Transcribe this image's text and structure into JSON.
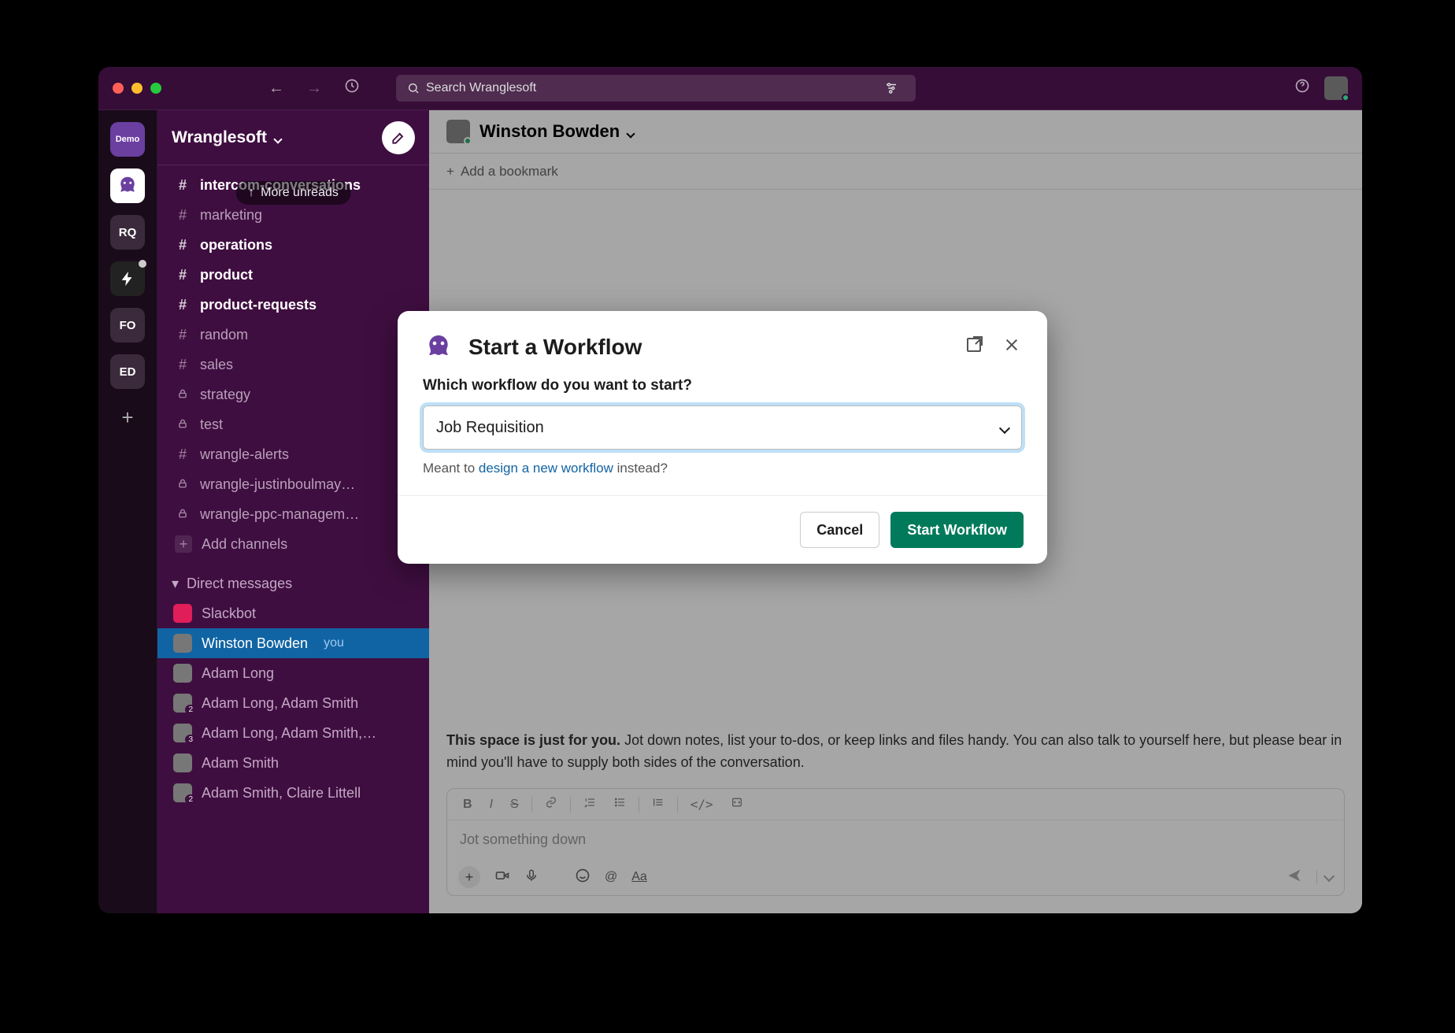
{
  "workspace": {
    "name": "Wranglesoft"
  },
  "search": {
    "placeholder": "Search Wranglesoft"
  },
  "rail": [
    {
      "label": "Demo",
      "kind": "demo"
    },
    {
      "label": "",
      "kind": "octo"
    },
    {
      "label": "RQ",
      "kind": "text"
    },
    {
      "label": "",
      "kind": "flash",
      "badge": true
    },
    {
      "label": "FO",
      "kind": "text",
      "badge": true
    },
    {
      "label": "ED",
      "kind": "text"
    }
  ],
  "unreads_pill": "More unreads",
  "channels": [
    {
      "name": "intercom-conversations",
      "icon": "#",
      "bold": true
    },
    {
      "name": "marketing",
      "icon": "#",
      "bold": false
    },
    {
      "name": "operations",
      "icon": "#",
      "bold": true
    },
    {
      "name": "product",
      "icon": "#",
      "bold": true
    },
    {
      "name": "product-requests",
      "icon": "#",
      "bold": true
    },
    {
      "name": "random",
      "icon": "#",
      "bold": false
    },
    {
      "name": "sales",
      "icon": "#",
      "bold": false
    },
    {
      "name": "strategy",
      "icon": "lock",
      "bold": false
    },
    {
      "name": "test",
      "icon": "lock",
      "bold": false
    },
    {
      "name": "wrangle-alerts",
      "icon": "#",
      "bold": false
    },
    {
      "name": "wrangle-justinboulmay…",
      "icon": "lock",
      "bold": false
    },
    {
      "name": "wrangle-ppc-managem…",
      "icon": "lock",
      "bold": false
    }
  ],
  "add_channels_label": "Add channels",
  "dm_section": "Direct messages",
  "dms": [
    {
      "name": "Slackbot"
    },
    {
      "name": "Winston Bowden",
      "you": "you",
      "active": true
    },
    {
      "name": "Adam Long"
    },
    {
      "name": "Adam Long, Adam Smith",
      "count": "2"
    },
    {
      "name": "Adam Long, Adam Smith,…",
      "count": "3"
    },
    {
      "name": "Adam Smith"
    },
    {
      "name": "Adam Smith, Claire Littell",
      "count": "2"
    }
  ],
  "main": {
    "title": "Winston Bowden",
    "bookmark": "Add a bookmark",
    "space_strong": "This space is just for you.",
    "space_rest": " Jot down notes, list your to-dos, or keep links and files handy. You can also talk to yourself here, but please bear in mind you'll have to supply both sides of the conversation.",
    "placeholder": "Jot something down"
  },
  "modal": {
    "title": "Start a Workflow",
    "question": "Which workflow do you want to start?",
    "selected": "Job Requisition",
    "hint_pre": "Meant to ",
    "hint_link": "design a new workflow",
    "hint_post": " instead?",
    "cancel": "Cancel",
    "confirm": "Start Workflow"
  }
}
